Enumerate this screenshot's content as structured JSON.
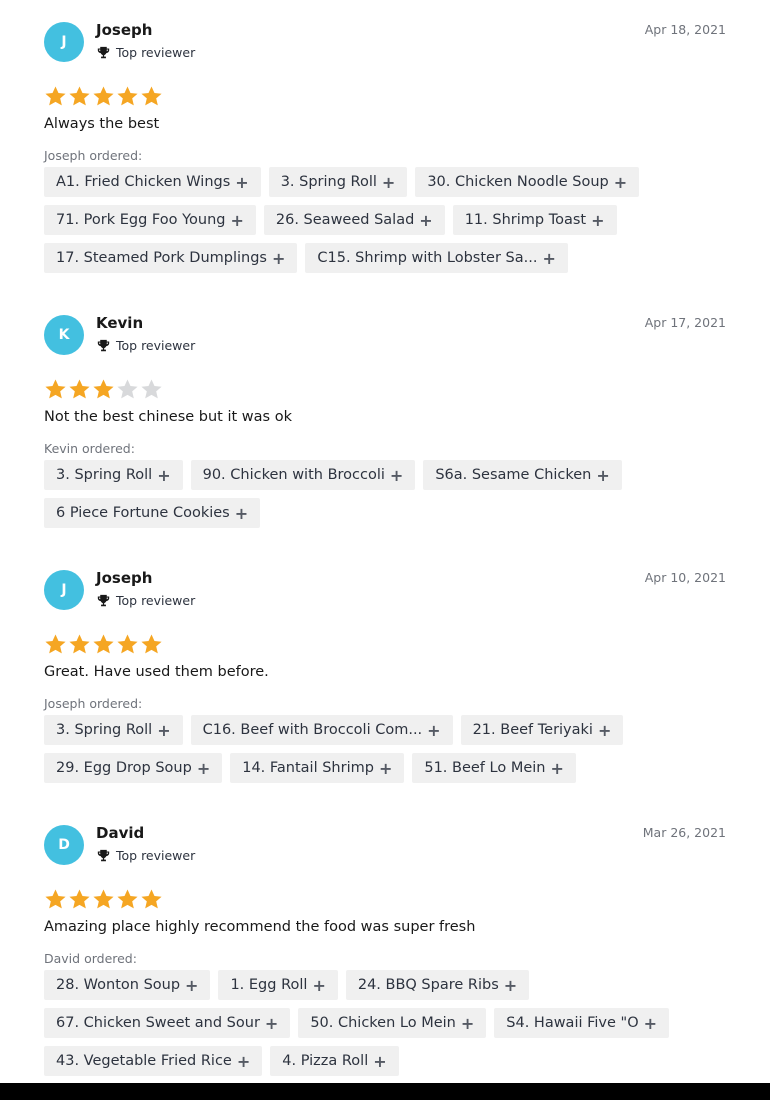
{
  "reviews": [
    {
      "initial": "J",
      "name": "Joseph",
      "badge": "Top reviewer",
      "date": "Apr 18, 2021",
      "rating": 5,
      "text": "Always the best",
      "ordered_label": "Joseph ordered:",
      "items": [
        [
          "A1. Fried Chicken Wings",
          "3. Spring Roll",
          "30. Chicken Noodle Soup"
        ],
        [
          "71. Pork Egg Foo Young",
          "26. Seaweed Salad",
          "11. Shrimp Toast"
        ],
        [
          "17. Steamed Pork Dumplings",
          "C15. Shrimp with Lobster Sa..."
        ]
      ]
    },
    {
      "initial": "K",
      "name": "Kevin",
      "badge": "Top reviewer",
      "date": "Apr 17, 2021",
      "rating": 3,
      "text": "Not the best chinese but it was ok",
      "ordered_label": "Kevin ordered:",
      "items": [
        [
          "3. Spring Roll",
          "90. Chicken with Broccoli",
          "S6a. Sesame Chicken"
        ],
        [
          "6 Piece Fortune Cookies"
        ]
      ]
    },
    {
      "initial": "J",
      "name": "Joseph",
      "badge": "Top reviewer",
      "date": "Apr 10, 2021",
      "rating": 5,
      "text": "Great. Have used them before.",
      "ordered_label": "Joseph ordered:",
      "items": [
        [
          "3. Spring Roll",
          "C16. Beef with Broccoli Com...",
          "21. Beef Teriyaki"
        ],
        [
          "29. Egg Drop Soup",
          "14. Fantail Shrimp",
          "51. Beef Lo Mein"
        ]
      ]
    },
    {
      "initial": "D",
      "name": "David",
      "badge": "Top reviewer",
      "date": "Mar 26, 2021",
      "rating": 5,
      "text": "Amazing place highly recommend the food was super fresh",
      "ordered_label": "David ordered:",
      "items": [
        [
          "28. Wonton Soup",
          "1. Egg Roll",
          "24. BBQ Spare Ribs"
        ],
        [
          "67. Chicken Sweet and Sour",
          "50. Chicken Lo Mein",
          "S4. Hawaii Five \"O"
        ],
        [
          "43. Vegetable Fried Rice",
          "4. Pizza Roll"
        ]
      ]
    }
  ],
  "chip_plus": "+",
  "colors": {
    "avatar": "#43c0e0",
    "star_filled": "#f5a623",
    "star_empty": "#d8d9db",
    "chip_bg": "#f0f0f0"
  }
}
